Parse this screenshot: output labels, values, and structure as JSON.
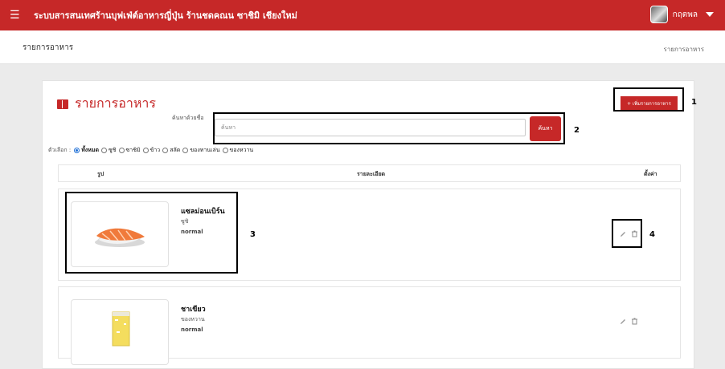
{
  "topbar": {
    "title": "ระบบสารสนเทศร้านบุฟเฟ่ต์อาหารญี่ปุ่น ร้านชดคณน ซาชิมิ เชียงใหม่",
    "user_name": "กฤตพล"
  },
  "subbar": {
    "page_title": "รายการอาหาร",
    "breadcrumb": "รายการอาหาร"
  },
  "content": {
    "section_title": "รายการอาหาร",
    "add_button_label": "+ เพิ่มรายการอาหาร",
    "search": {
      "label": "ค้นหาด้วยชื่อ",
      "placeholder": "ค้นหา",
      "button_label": "ค้นหา"
    },
    "filter": {
      "label": "ตัวเลือก :",
      "options": [
        {
          "label": "ทั้งหมด",
          "checked": true
        },
        {
          "label": "ซูชิ",
          "checked": false
        },
        {
          "label": "ซาชิมิ",
          "checked": false
        },
        {
          "label": "ข้าว",
          "checked": false
        },
        {
          "label": "สลัด",
          "checked": false
        },
        {
          "label": "ของทานเล่น",
          "checked": false
        },
        {
          "label": "ของหวาน",
          "checked": false
        }
      ]
    },
    "table": {
      "headers": {
        "image": "รูป",
        "detail": "รายละเอียด",
        "settings": "ตั้งค่า"
      },
      "rows": [
        {
          "name": "แซลม่อนเบิร์น",
          "category": "ซูชิ",
          "status": "normal",
          "image_icon": "salmon-sushi-image"
        },
        {
          "name": "ชาเขียว",
          "category": "ของหวาน",
          "status": "normal",
          "image_icon": "green-tea-drink-image"
        }
      ]
    }
  },
  "annotations": [
    "1",
    "2",
    "3",
    "4"
  ],
  "colors": {
    "primary": "#c62828",
    "radio_checked": "#1e6fd6"
  }
}
